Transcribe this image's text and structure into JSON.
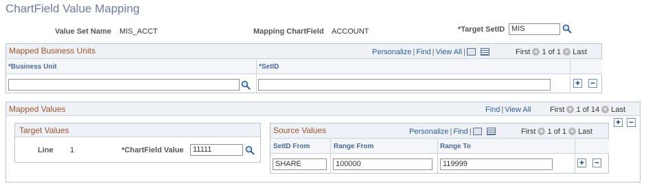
{
  "page": {
    "title": "ChartField Value Mapping"
  },
  "header": {
    "value_set_name_label": "Value Set Name",
    "value_set_name_value": "MIS_ACCT",
    "mapping_chartfield_label": "Mapping ChartField",
    "mapping_chartfield_value": "ACCOUNT",
    "target_setid_label": "*Target SetID",
    "target_setid_value": "MIS"
  },
  "mapped_business_units": {
    "title": "Mapped Business Units",
    "personalize": "Personalize",
    "find": "Find",
    "view_all": "View All",
    "first": "First",
    "range": "1 of 1",
    "last": "Last",
    "columns": [
      "*Business Unit",
      "*SetID"
    ],
    "row": {
      "business_unit": "",
      "setid": ""
    }
  },
  "mapped_values": {
    "title": "Mapped Values",
    "find": "Find",
    "view_all": "View All",
    "first": "First",
    "range": "1 of 14",
    "last": "Last",
    "target_values": {
      "title": "Target Values",
      "line_label": "Line",
      "line_value": "1",
      "chartfield_value_label": "*ChartField Value",
      "chartfield_value": "11111"
    },
    "source_values": {
      "title": "Source Values",
      "personalize": "Personalize",
      "find": "Find",
      "first": "First",
      "range": "1 of 1",
      "last": "Last",
      "columns": [
        "SetID From",
        "Range From",
        "Range To"
      ],
      "row": {
        "setid_from": "SHARE",
        "range_from": "100000",
        "range_to": "119999"
      }
    }
  },
  "buttons": {
    "add": "+",
    "delete": "−"
  },
  "icons": {
    "lookup": "magnifier-icon",
    "download": "download-icon",
    "grid": "grid-icon",
    "prev": "arrow-left-icon",
    "next": "arrow-right-icon"
  },
  "colors": {
    "title": "#6a7d9e",
    "section_title": "#a0522d",
    "link": "#2a5d9a",
    "column_header": "#4a6a9c"
  }
}
